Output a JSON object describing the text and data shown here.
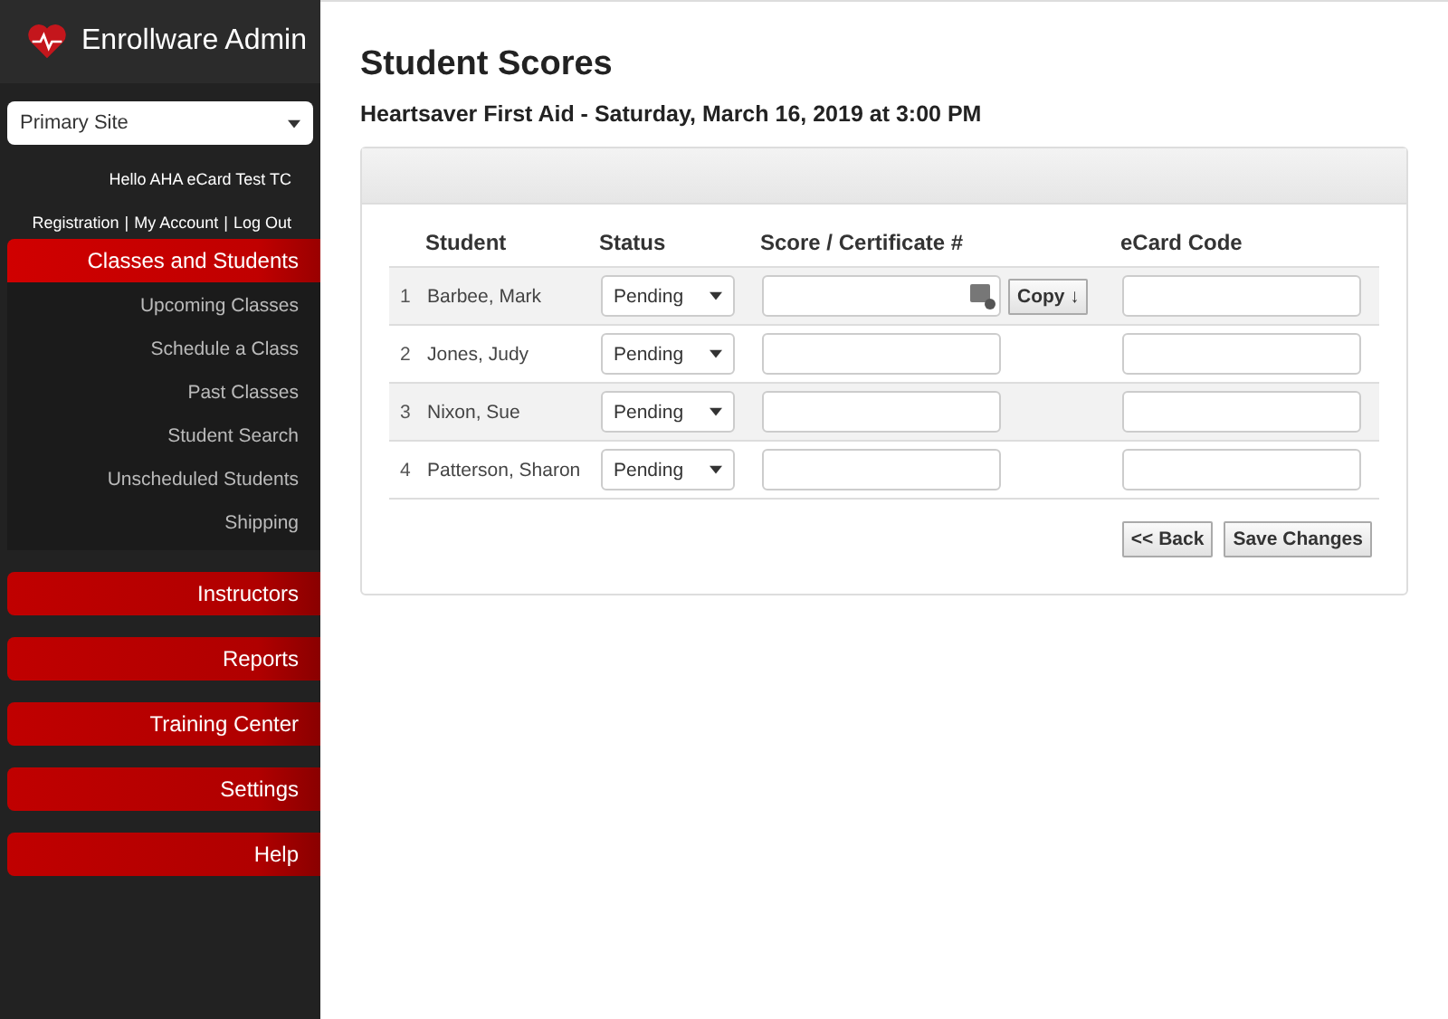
{
  "sidebar": {
    "brand": "Enrollware Admin",
    "site_select": {
      "value": "Primary Site"
    },
    "greeting": "Hello AHA eCard Test TC",
    "account_links": [
      "Registration",
      "My Account",
      "Log Out"
    ],
    "link_separator": "|",
    "nav": [
      {
        "label": "Classes and Students",
        "expanded": true,
        "children": [
          "Upcoming Classes",
          "Schedule a Class",
          "Past Classes",
          "Student Search",
          "Unscheduled Students",
          "Shipping"
        ]
      },
      {
        "label": "Instructors",
        "expanded": false
      },
      {
        "label": "Reports",
        "expanded": false
      },
      {
        "label": "Training Center",
        "expanded": false
      },
      {
        "label": "Settings",
        "expanded": false
      },
      {
        "label": "Help",
        "expanded": false
      }
    ]
  },
  "page": {
    "title": "Student Scores",
    "subtitle": "Heartsaver First Aid - Saturday, March 16, 2019 at 3:00 PM"
  },
  "table": {
    "columns": [
      "Student",
      "Status",
      "Score / Certificate #",
      "eCard Code"
    ],
    "rows": [
      {
        "number": "1",
        "student": "Barbee, Mark",
        "status": "Pending",
        "copy_button": "Copy ↓"
      },
      {
        "number": "2",
        "student": "Jones, Judy",
        "status": "Pending"
      },
      {
        "number": "3",
        "student": "Nixon, Sue",
        "status": "Pending"
      },
      {
        "number": "4",
        "student": "Patterson, Sharon",
        "status": "Pending"
      }
    ]
  },
  "buttons": [
    "<< Back",
    "Save Changes"
  ]
}
